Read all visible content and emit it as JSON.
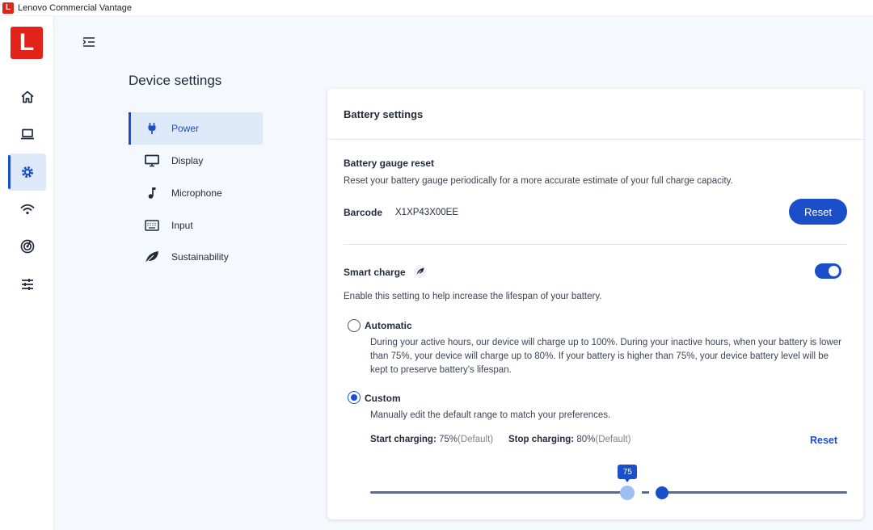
{
  "window": {
    "title": "Lenovo Commercial Vantage",
    "logo_letter": "L"
  },
  "rail": {
    "logo_letter": "L",
    "items": [
      {
        "icon": "home-icon"
      },
      {
        "icon": "laptop-icon"
      },
      {
        "icon": "gear-icon",
        "active": true
      },
      {
        "icon": "wifi-icon"
      },
      {
        "icon": "radar-icon"
      },
      {
        "icon": "sliders-icon"
      }
    ]
  },
  "page": {
    "title": "Device settings"
  },
  "subnav": {
    "items": [
      {
        "label": "Power",
        "icon": "plug-icon",
        "active": true
      },
      {
        "label": "Display",
        "icon": "monitor-icon"
      },
      {
        "label": "Microphone",
        "icon": "music-note-icon"
      },
      {
        "label": "Input",
        "icon": "keyboard-icon"
      },
      {
        "label": "Sustainability",
        "icon": "leaf-icon"
      }
    ]
  },
  "battery": {
    "card_title": "Battery settings",
    "gauge_title": "Battery gauge reset",
    "gauge_desc": "Reset your battery gauge periodically for a more accurate estimate of your full charge capacity.",
    "barcode_label": "Barcode",
    "barcode_value": "X1XP43X00EE",
    "reset_label": "Reset",
    "smart_title": "Smart charge",
    "smart_enabled": true,
    "smart_desc": "Enable this setting to help increase the lifespan of your battery.",
    "auto_label": "Automatic",
    "auto_desc": "During your active hours, our device will charge up to 100%. During your inactive hours, when your battery is lower than 75%, your device will charge up to 80%. If your battery is higher than 75%, your device battery level will be kept to preserve battery's lifespan.",
    "custom_label": "Custom",
    "custom_selected": true,
    "custom_desc": "Manually edit the default range to match your preferences.",
    "start_label": "Start charging:",
    "start_value": "75%",
    "start_default": "(Default)",
    "stop_label": "Stop charging:",
    "stop_value": "80%",
    "stop_default": "(Default)",
    "custom_reset_label": "Reset",
    "slider": {
      "min": 0,
      "max": 100,
      "start": 75,
      "stop": 80,
      "tooltip": "75"
    }
  },
  "colors": {
    "accent": "#1a4fc9",
    "brand": "#e2231a"
  }
}
